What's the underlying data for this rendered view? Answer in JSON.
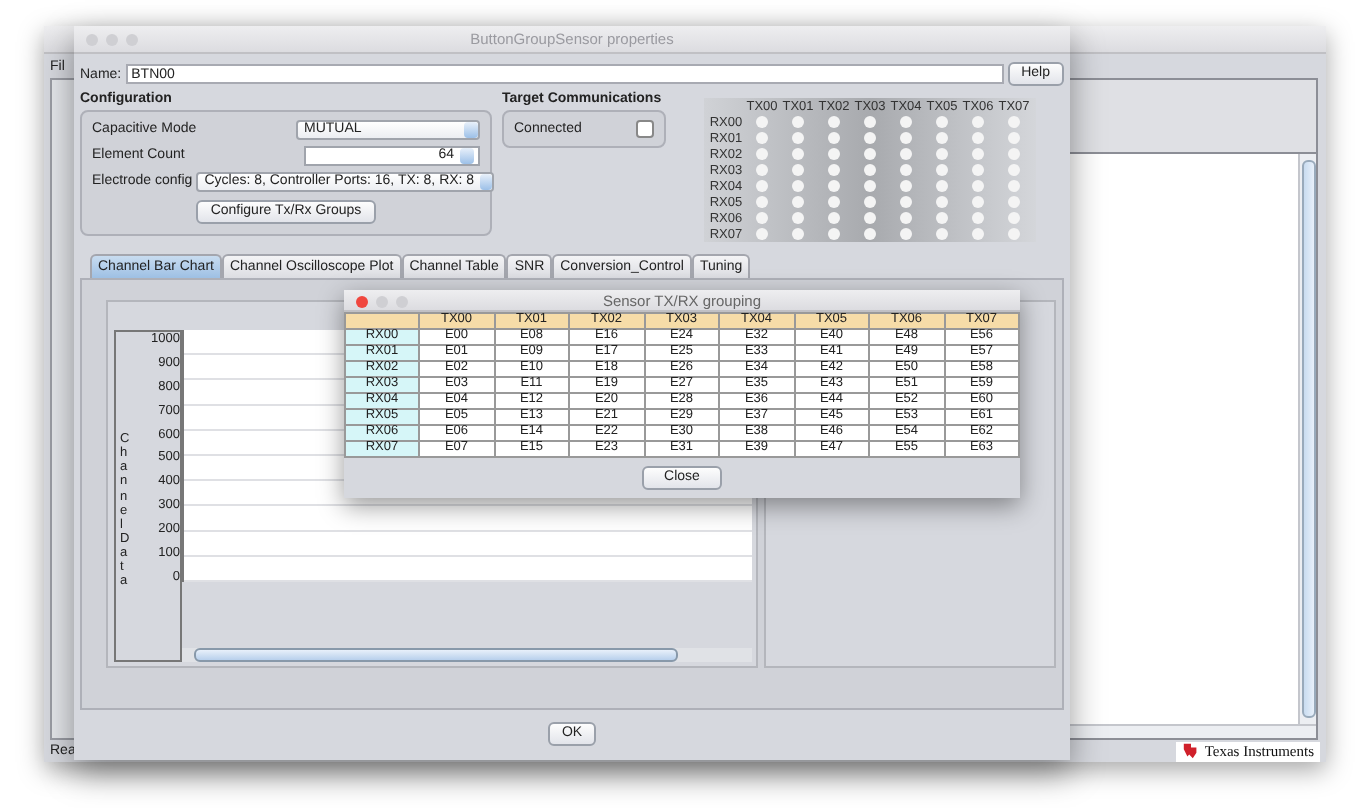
{
  "app_window": {
    "menu": [
      "Fil"
    ],
    "status": "Rea",
    "logo_text": "Texas Instruments"
  },
  "properties_dialog": {
    "title": "ButtonGroupSensor properties",
    "name_label": "Name:",
    "name_value": "BTN00",
    "help_button": "Help",
    "configuration": {
      "title": "Configuration",
      "rows": [
        {
          "kind": "combo",
          "label": "Capacitive Mode",
          "value": "MUTUAL"
        },
        {
          "kind": "spinner",
          "label": "Element Count",
          "value": "64"
        },
        {
          "kind": "combo",
          "label": "Electrode config",
          "value": "Cycles:  8, Controller Ports: 16, TX:  8, RX:  8"
        }
      ],
      "button": "Configure Tx/Rx Groups"
    },
    "target": {
      "title": "Target Communications",
      "label": "Connected",
      "checked": false
    },
    "matrix": {
      "tx": [
        "TX00",
        "TX01",
        "TX02",
        "TX03",
        "TX04",
        "TX05",
        "TX06",
        "TX07"
      ],
      "rx": [
        "RX00",
        "RX01",
        "RX02",
        "RX03",
        "RX04",
        "RX05",
        "RX06",
        "RX07"
      ]
    },
    "tabs": [
      {
        "label": "Channel Bar Chart",
        "selected": true
      },
      {
        "label": "Channel Oscilloscope Plot",
        "selected": false
      },
      {
        "label": "Channel Table",
        "selected": false
      },
      {
        "label": "SNR",
        "selected": false
      },
      {
        "label": "Conversion_Control",
        "selected": false
      },
      {
        "label": "Tuning",
        "selected": false
      }
    ],
    "chart": {
      "ylabel": "Channel Data",
      "yticks": [
        "1000",
        "900",
        "800",
        "700",
        "600",
        "500",
        "400",
        "300",
        "200",
        "100",
        "0"
      ]
    },
    "ok_button": "OK"
  },
  "grouping_dialog": {
    "title": "Sensor TX/RX grouping",
    "columns": [
      "TX00",
      "TX01",
      "TX02",
      "TX03",
      "TX04",
      "TX05",
      "TX06",
      "TX07"
    ],
    "rows": [
      {
        "header": "RX00",
        "cells": [
          "E00",
          "E08",
          "E16",
          "E24",
          "E32",
          "E40",
          "E48",
          "E56"
        ]
      },
      {
        "header": "RX01",
        "cells": [
          "E01",
          "E09",
          "E17",
          "E25",
          "E33",
          "E41",
          "E49",
          "E57"
        ]
      },
      {
        "header": "RX02",
        "cells": [
          "E02",
          "E10",
          "E18",
          "E26",
          "E34",
          "E42",
          "E50",
          "E58"
        ]
      },
      {
        "header": "RX03",
        "cells": [
          "E03",
          "E11",
          "E19",
          "E27",
          "E35",
          "E43",
          "E51",
          "E59"
        ]
      },
      {
        "header": "RX04",
        "cells": [
          "E04",
          "E12",
          "E20",
          "E28",
          "E36",
          "E44",
          "E52",
          "E60"
        ]
      },
      {
        "header": "RX05",
        "cells": [
          "E05",
          "E13",
          "E21",
          "E29",
          "E37",
          "E45",
          "E53",
          "E61"
        ]
      },
      {
        "header": "RX06",
        "cells": [
          "E06",
          "E14",
          "E22",
          "E30",
          "E38",
          "E46",
          "E54",
          "E62"
        ]
      },
      {
        "header": "RX07",
        "cells": [
          "E07",
          "E15",
          "E23",
          "E31",
          "E39",
          "E47",
          "E55",
          "E63"
        ]
      }
    ],
    "close_button": "Close"
  }
}
